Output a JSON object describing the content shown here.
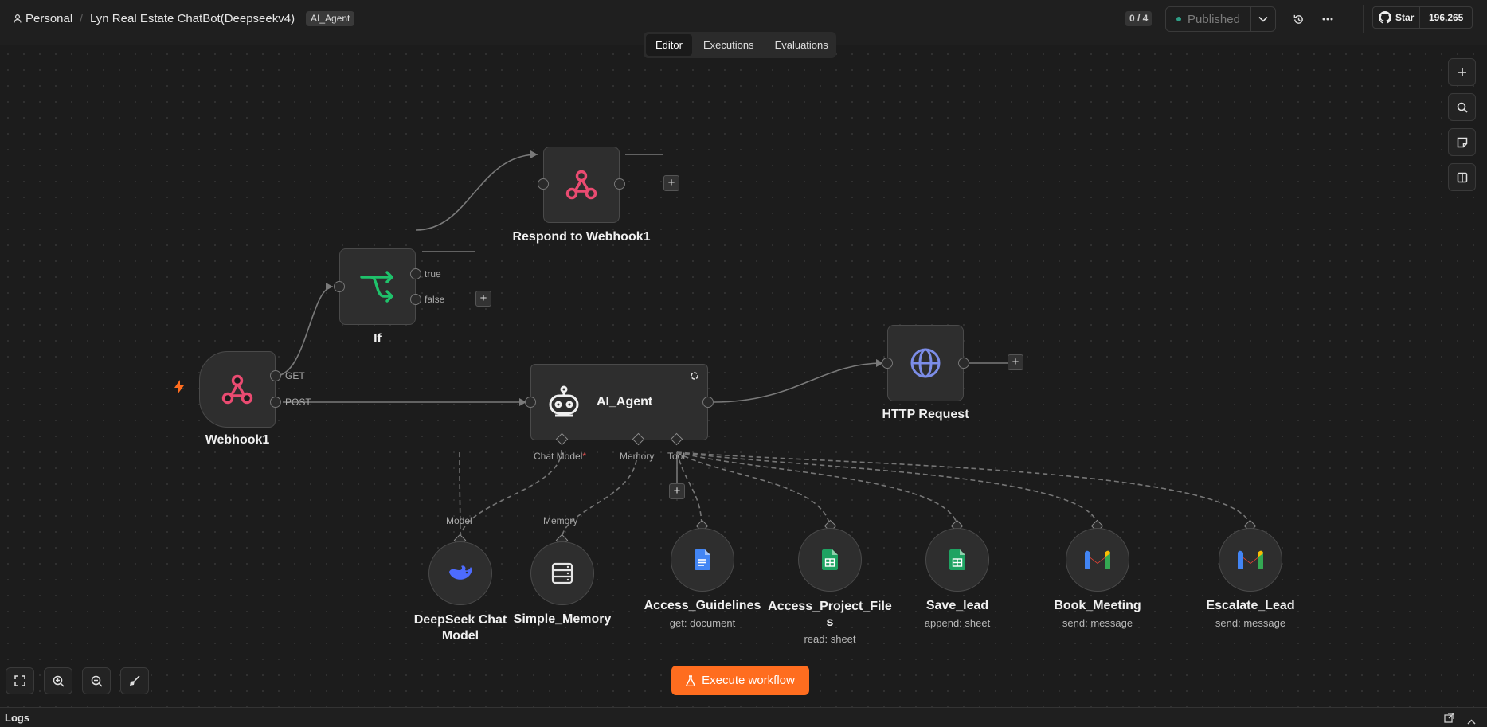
{
  "header": {
    "breadcrumb_personal": "Personal",
    "breadcrumb_separator": "/",
    "workflow_title": "Lyn Real Estate ChatBot(Deepseekv4)",
    "tag": "AI_Agent",
    "test_counter": "0 / 4",
    "publish_label": "Published",
    "github_star_label": "Star",
    "github_star_count": "196,265"
  },
  "tabs": [
    {
      "label": "Editor",
      "active": true
    },
    {
      "label": "Executions",
      "active": false
    },
    {
      "label": "Evaluations",
      "active": false
    }
  ],
  "nodes": {
    "webhook": {
      "label": "Webhook1",
      "port_get": "GET",
      "port_post": "POST"
    },
    "if": {
      "label": "If",
      "port_true": "true",
      "port_false": "false"
    },
    "respond": {
      "label": "Respond to Webhook1"
    },
    "agent": {
      "label": "AI_Agent",
      "port_chat_model": "Chat Model",
      "port_chat_model_required": "*",
      "port_memory": "Memory",
      "port_tool": "Tool"
    },
    "http": {
      "label": "HTTP Request"
    },
    "deepseek": {
      "label_line1": "DeepSeek Chat",
      "label_line2": "Model",
      "port": "Model"
    },
    "memory": {
      "label": "Simple_Memory",
      "port": "Memory"
    },
    "guidelines": {
      "label": "Access_Guidelines",
      "sub": "get: document"
    },
    "project_files": {
      "label_line1": "Access_Project_File",
      "label_line2": "s",
      "sub": "read: sheet"
    },
    "save_lead": {
      "label": "Save_lead",
      "sub": "append: sheet"
    },
    "book_meeting": {
      "label": "Book_Meeting",
      "sub": "send: message"
    },
    "escalate": {
      "label": "Escalate_Lead",
      "sub": "send: message"
    }
  },
  "plus_symbol": "+",
  "execute_button": "Execute workflow",
  "logs_label": "Logs",
  "colors": {
    "accent": "#ff6d1f",
    "webhook_icon": "#ea4b71",
    "if_icon": "#1fc26b",
    "http_icon": "#7c8de8",
    "deepseek_icon": "#4d6bfe",
    "docs_icon": "#4285f4",
    "sheets_icon": "#1ea362",
    "published_dot": "#2e9e86"
  },
  "icons": {
    "personal": "user-icon",
    "webhook": "webhook-icon",
    "if": "branch-icon",
    "agent": "robot-icon",
    "http": "globe-icon",
    "deepseek": "whale-icon",
    "memory": "database-icon",
    "guidelines": "google-docs-icon",
    "project_files": "google-sheets-icon",
    "save_lead": "google-sheets-icon",
    "book_meeting": "gmail-icon",
    "escalate": "gmail-icon"
  }
}
